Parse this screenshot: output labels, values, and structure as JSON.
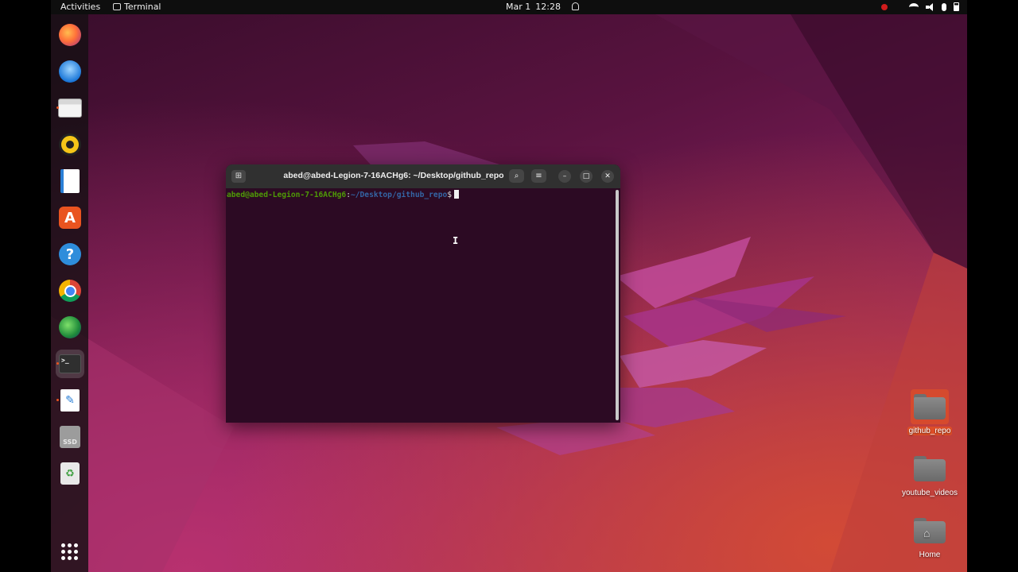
{
  "topbar": {
    "activities": "Activities",
    "app_name": "Terminal",
    "date": "Mar 1",
    "time": "12:28"
  },
  "dock": {
    "items": [
      {
        "name": "Firefox",
        "icon": "firefox-icon"
      },
      {
        "name": "Thunderbird",
        "icon": "thunderbird-icon"
      },
      {
        "name": "Files",
        "icon": "files-icon"
      },
      {
        "name": "Rhythmbox",
        "icon": "rhythmbox-icon"
      },
      {
        "name": "LibreOffice Writer",
        "icon": "writer-icon"
      },
      {
        "name": "Ubuntu Software",
        "icon": "software-center-icon"
      },
      {
        "name": "Help",
        "icon": "help-icon"
      },
      {
        "name": "Google Chrome",
        "icon": "chrome-icon"
      },
      {
        "name": "Globe app",
        "icon": "globe-icon"
      },
      {
        "name": "Terminal",
        "icon": "terminal-icon"
      },
      {
        "name": "Text Editor",
        "icon": "text-editor-icon"
      },
      {
        "name": "SSD",
        "icon": "ssd-drive-icon",
        "label": "SSD"
      },
      {
        "name": "Trash",
        "icon": "trash-icon"
      }
    ],
    "show_apps_icon": "apps-grid-icon"
  },
  "terminal": {
    "title": "abed@abed-Legion-7-16ACHg6: ~/Desktop/github_repo",
    "prompt_user": "abed@abed-Legion-7-16ACHg6",
    "prompt_colon": ":",
    "prompt_path": "~/Desktop/github_repo",
    "prompt_dollar": "$"
  },
  "desktop": {
    "icons": [
      {
        "label": "github_repo",
        "icon": "folder-icon",
        "selected": true
      },
      {
        "label": "youtube_videos",
        "icon": "folder-icon",
        "selected": false
      },
      {
        "label": "Home",
        "icon": "home-folder-icon",
        "selected": false
      }
    ]
  },
  "colors": {
    "accent": "#e95420",
    "terminal_bg": "#2c0a23",
    "prompt_user": "#4e9a06",
    "prompt_path": "#3465a4"
  }
}
